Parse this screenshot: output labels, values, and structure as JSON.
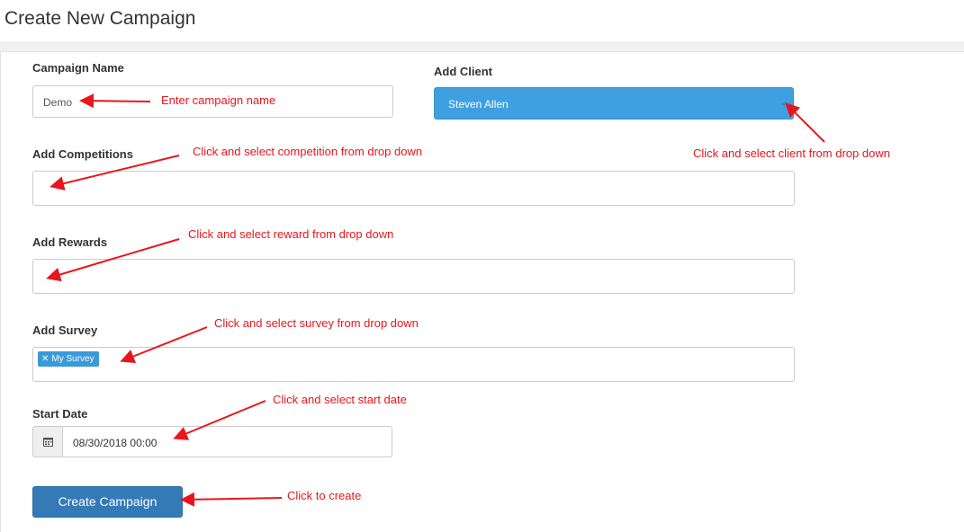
{
  "page": {
    "title": "Create New Campaign"
  },
  "form": {
    "campaign_name": {
      "label": "Campaign Name",
      "value": "Demo"
    },
    "client": {
      "label": "Add Client",
      "value": "Steven Allen"
    },
    "competitions": {
      "label": "Add Competitions",
      "value": ""
    },
    "rewards": {
      "label": "Add Rewards",
      "value": ""
    },
    "survey": {
      "label": "Add Survey",
      "tags": [
        "My Survey"
      ]
    },
    "start_date": {
      "label": "Start Date",
      "value": "08/30/2018 00:00"
    },
    "submit": {
      "label": "Create Campaign"
    }
  },
  "annotations": {
    "campaign_name": "Enter campaign name",
    "client": "Click and select client from drop down",
    "competitions": "Click and select competition from drop down",
    "rewards": "Click and select reward from drop down",
    "survey": "Click and select survey from drop down",
    "start_date": "Click and select start date",
    "submit": "Click to create"
  },
  "colors": {
    "annotation": "#e8161c",
    "primary_button": "#337ab7",
    "select_highlight": "#3fa0e1"
  },
  "icons": {
    "calendar": "calendar-icon",
    "dropdown": "chevron-down-icon",
    "tag_remove": "close-icon"
  }
}
